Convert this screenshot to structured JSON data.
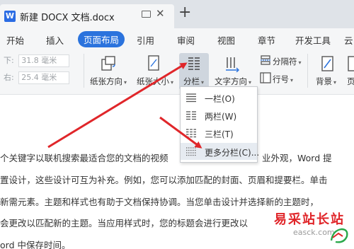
{
  "title_bar": {
    "doc_icon_letter": "W",
    "tab_title": "新建 DOCX 文档.docx",
    "close_glyph": "✕",
    "add_glyph": "+"
  },
  "menu": {
    "items": [
      "开始",
      "插入",
      "页面布局",
      "引用",
      "审阅",
      "视图",
      "章节",
      "开发工具",
      "云"
    ],
    "active": "页面布局"
  },
  "ribbon": {
    "margin_bottom_label": "下:",
    "margin_bottom_value": "31.8 毫米",
    "margin_right_label": "右:",
    "margin_right_value": "25.4 毫米",
    "orientation_label": "纸张方向",
    "size_label": "纸张大小",
    "columns_label": "分栏",
    "text_direction_label": "文字方向",
    "separator_label": "分隔符",
    "line_number_label": "行号",
    "background_label": "背景",
    "border_label": "页",
    "caret": "▾"
  },
  "columns_menu": {
    "items": [
      "一栏(O)",
      "两栏(W)",
      "三栏(T)",
      "更多分栏(C)..."
    ],
    "highlighted": "更多分栏(C)..."
  },
  "document": {
    "lines": [
      "个关键字以联机搜索最适合您的文档的视频",
      "业外观，Word 提",
      "置设计，这些设计可互为补充。例如，您可以添加匹配的封面、页眉和提要栏。单击",
      "新需元素。主题和样式也有助于文档保持协调。当您单击设计并选择新的主题时，",
      "会更改以匹配新的主题。当应用样式时，您的标题会进行更改以",
      "ord 中保存时间。"
    ]
  },
  "watermark": {
    "title": "易采站长站",
    "url": "easck.com"
  },
  "colors": {
    "accent": "#2b73dd",
    "arrow": "#e0262a",
    "watermark_red": "#e0262a"
  }
}
